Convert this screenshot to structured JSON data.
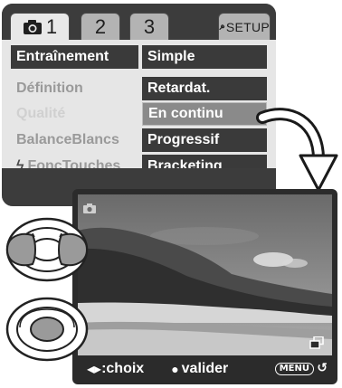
{
  "menu": {
    "tabs": [
      {
        "id": "1",
        "label": "1",
        "active": true,
        "icon": "camera-icon"
      },
      {
        "id": "2",
        "label": "2",
        "active": false
      },
      {
        "id": "3",
        "label": "3",
        "active": false
      },
      {
        "id": "setup",
        "label": "SETUP",
        "active": false,
        "icon": "wrench-icon"
      }
    ],
    "rows": [
      {
        "name": "Entraînement",
        "value": "Simple",
        "selected": true
      },
      {
        "name": "Définition",
        "value": "Retardat.",
        "selected": false
      },
      {
        "name": "Qualité",
        "value": "En continu",
        "selected": false,
        "highlighted": true
      },
      {
        "name": "BalanceBlancs",
        "value": "Progressif",
        "selected": false
      },
      {
        "name": "FoncTouches",
        "value": "Bracketing",
        "selected": false,
        "icon": "flash-icon"
      }
    ]
  },
  "screen": {
    "status": {
      "nav_text": ":choix",
      "nav_icon": "left-right-arrows-icon",
      "confirm_icon": "center-dot-icon",
      "confirm_text": "valider",
      "menu_label": "MENU",
      "return_icon": "return-arrow-icon"
    }
  },
  "colors": {
    "menu_dark": "#3c3c3c",
    "menu_body": "#e6e6e6",
    "value_bg": "#3a3a3a",
    "highlight_bg": "#8a8a8a",
    "controller_gray": "#9a9a9a",
    "screen_frame": "#2b2b2b"
  }
}
